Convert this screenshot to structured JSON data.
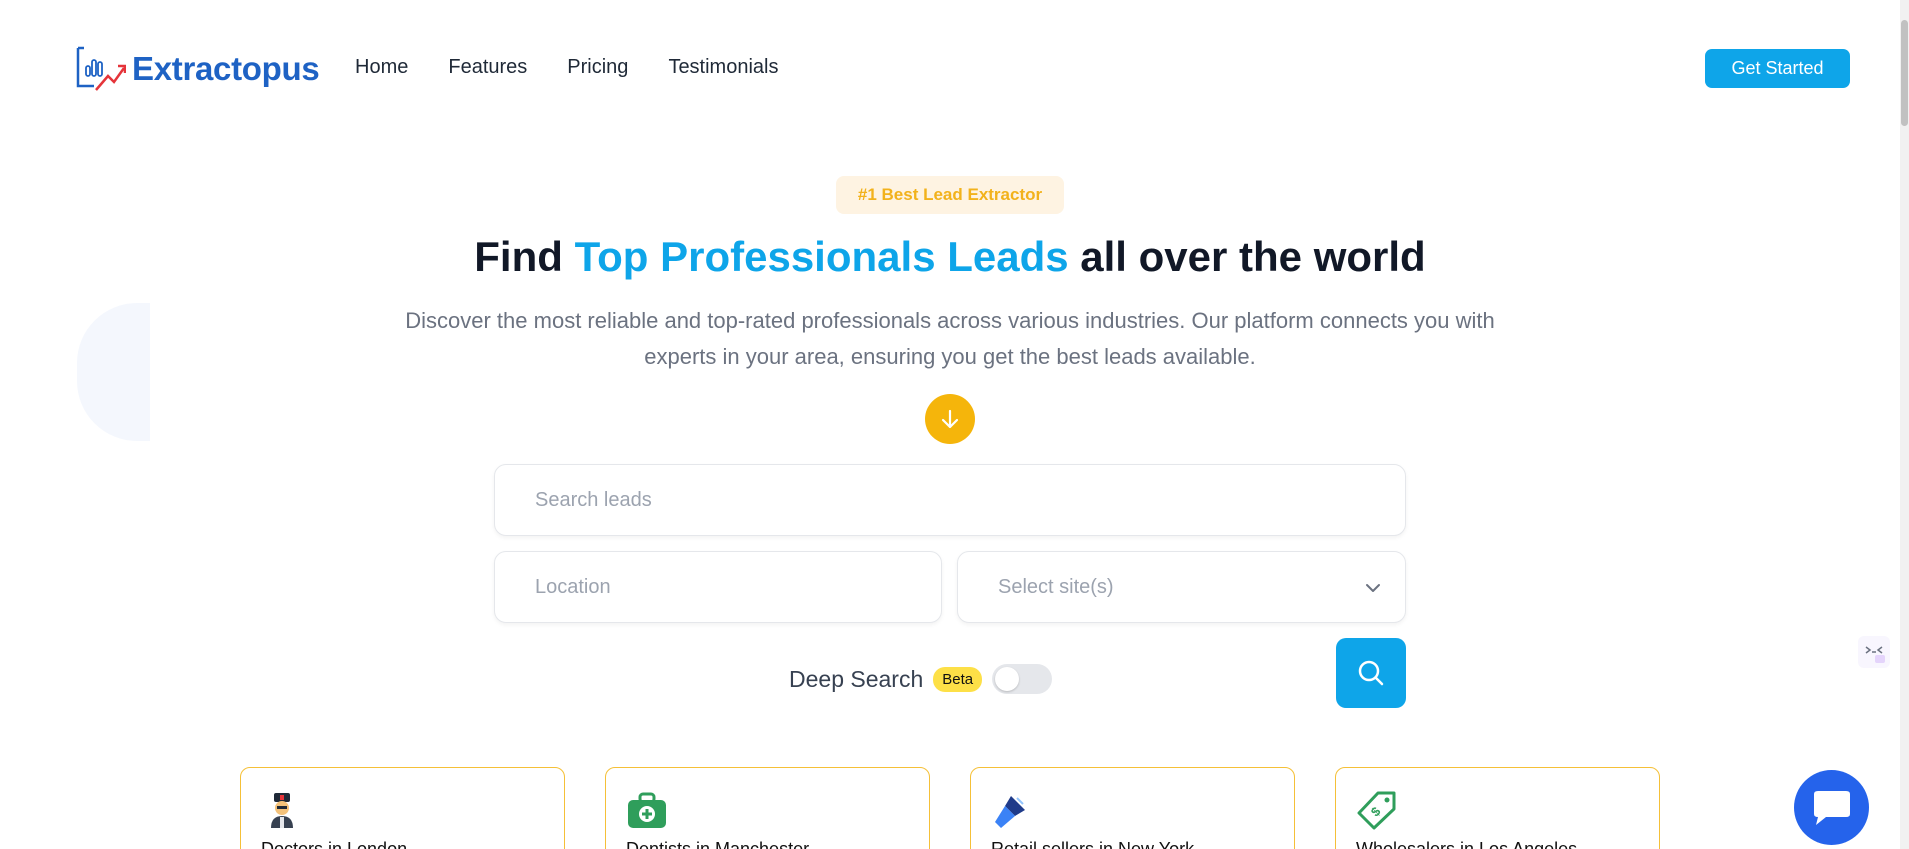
{
  "header": {
    "brand": "Extractopus",
    "nav": [
      "Home",
      "Features",
      "Pricing",
      "Testimonials"
    ],
    "cta": "Get Started"
  },
  "hero": {
    "badge": "#1 Best Lead Extractor",
    "headline_pre": "Find ",
    "headline_accent": "Top Professionals Leads",
    "headline_post": " all over the world",
    "description": "Discover the most reliable and top-rated professionals across various industries. Our platform connects you with experts in your area, ensuring you get the best leads available."
  },
  "search": {
    "query_placeholder": "Search leads",
    "location_placeholder": "Location",
    "site_placeholder": "Select site(s)",
    "deep_search_label": "Deep Search",
    "beta_label": "Beta",
    "deep_search_enabled": false
  },
  "cards": [
    {
      "title": "Doctors in London",
      "icon": "doctor-icon"
    },
    {
      "title": "Dentists in Manchester",
      "icon": "medical-kit-icon"
    },
    {
      "title": "Retail sellers in New York",
      "icon": "flashlight-icon"
    },
    {
      "title": "Wholesalers in Los Angeles",
      "icon": "price-tag-icon"
    }
  ],
  "colors": {
    "brand": "#1e62c4",
    "accent": "#0ea5e9",
    "yellow": "#f5b50b",
    "chat": "#2563eb"
  }
}
